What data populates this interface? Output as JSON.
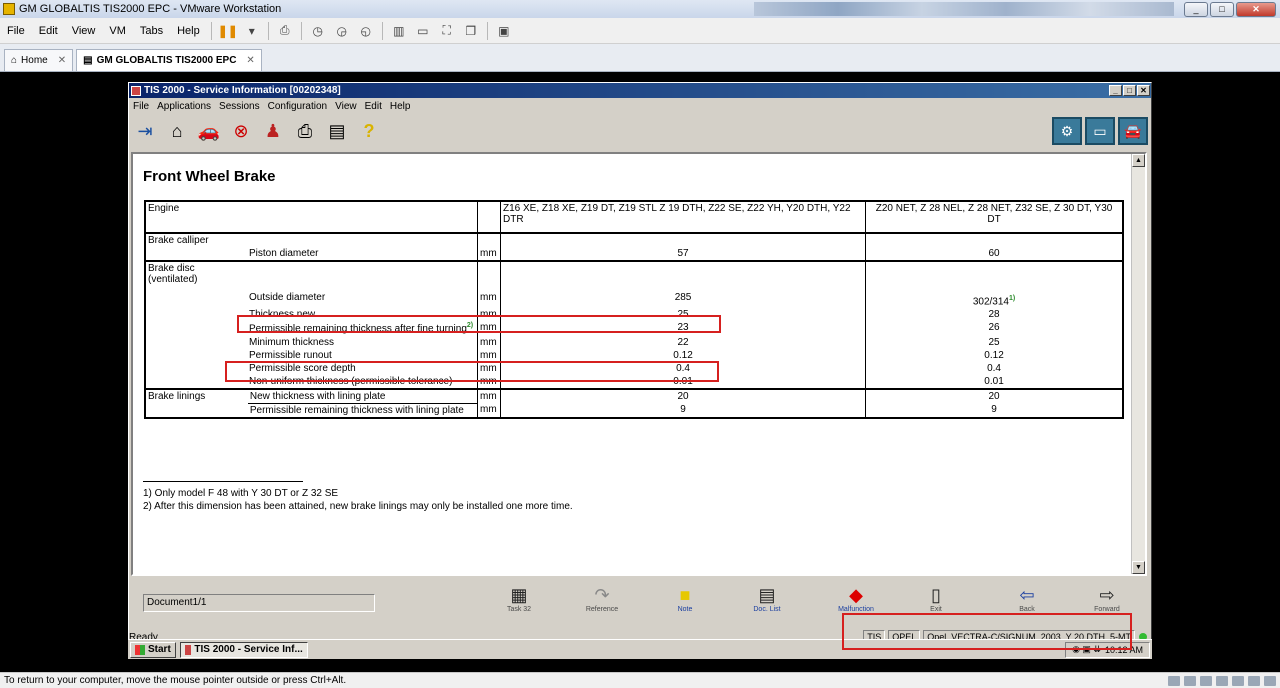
{
  "vmware": {
    "window_title": "GM GLOBALTIS TIS2000 EPC - VMware Workstation",
    "menu": [
      "File",
      "Edit",
      "View",
      "VM",
      "Tabs",
      "Help"
    ],
    "tabs": [
      {
        "label": "Home"
      },
      {
        "label": "GM GLOBALTIS TIS2000 EPC"
      }
    ],
    "status_text": "To return to your computer, move the mouse pointer outside or press Ctrl+Alt."
  },
  "tis": {
    "window_title": "TIS 2000 - Service Information [00202348]",
    "menu": [
      "File",
      "Applications",
      "Sessions",
      "Configuration",
      "View",
      "Edit",
      "Help"
    ],
    "document": {
      "title": "Front Wheel Brake",
      "header": {
        "engine_label": "Engine",
        "col1": "Z16 XE, Z18 XE, Z19 DT, Z19 STL Z 19 DTH, Z22 SE, Z22 YH, Y20 DTH, Y22 DTR",
        "col2": "Z20 NET, Z 28 NEL, Z 28 NET, Z32 SE, Z 30 DT, Y30 DT"
      },
      "groups": {
        "caliper": {
          "label": "Brake calliper",
          "rows": [
            {
              "param": "Piston diameter",
              "unit": "mm",
              "v1": "57",
              "v2": "60"
            }
          ]
        },
        "disc": {
          "label": "Brake disc",
          "sublabel": "(ventilated)",
          "rows": [
            {
              "param": "Outside diameter",
              "unit": "mm",
              "v1": "285",
              "v2": "302/314",
              "v2_sup": "1)"
            },
            {
              "param": "Thickness new",
              "unit": "mm",
              "v1": "25",
              "v2": "28"
            },
            {
              "param": "Permissible remaining thickness after fine turning",
              "param_sup": "2)",
              "unit": "mm",
              "v1": "23",
              "v2": "26"
            },
            {
              "param": "Minimum thickness",
              "unit": "mm",
              "v1": "22",
              "v2": "25"
            },
            {
              "param": "Permissible runout",
              "unit": "mm",
              "v1": "0.12",
              "v2": "0.12"
            },
            {
              "param": "Permissible score depth",
              "unit": "mm",
              "v1": "0.4",
              "v2": "0.4"
            },
            {
              "param": "Non-uniform thickness (permissible tolerance)",
              "unit": "mm",
              "v1": "0.01",
              "v2": "0.01"
            }
          ]
        },
        "linings": {
          "label": "Brake linings",
          "rows": [
            {
              "param": "New thickness with lining plate",
              "unit": "mm",
              "v1": "20",
              "v2": "20"
            },
            {
              "param": "Permissible remaining thickness with lining plate",
              "unit": "mm",
              "v1": "9",
              "v2": "9"
            }
          ]
        }
      },
      "footnotes": [
        "1) Only model F 48 with Y 30 DT or Z 32 SE",
        "2) After this dimension has been attained, new brake linings may only be installed one more time."
      ]
    },
    "bottom": {
      "doc_indicator": "Document1/1",
      "buttons": [
        "Task 32",
        "Reference",
        "Note",
        "Doc. List",
        "Malfunction",
        "Exit",
        "Back",
        "Forward"
      ]
    },
    "status": {
      "ready": "Ready",
      "fields": [
        "TIS",
        "OPEL",
        "Opel, VECTRA-C/SIGNUM, 2003, Y 20 DTH, 5-MT"
      ]
    },
    "taskbar": {
      "start": "Start",
      "task": "TIS 2000 - Service Inf...",
      "clock": "10:12 AM"
    }
  }
}
